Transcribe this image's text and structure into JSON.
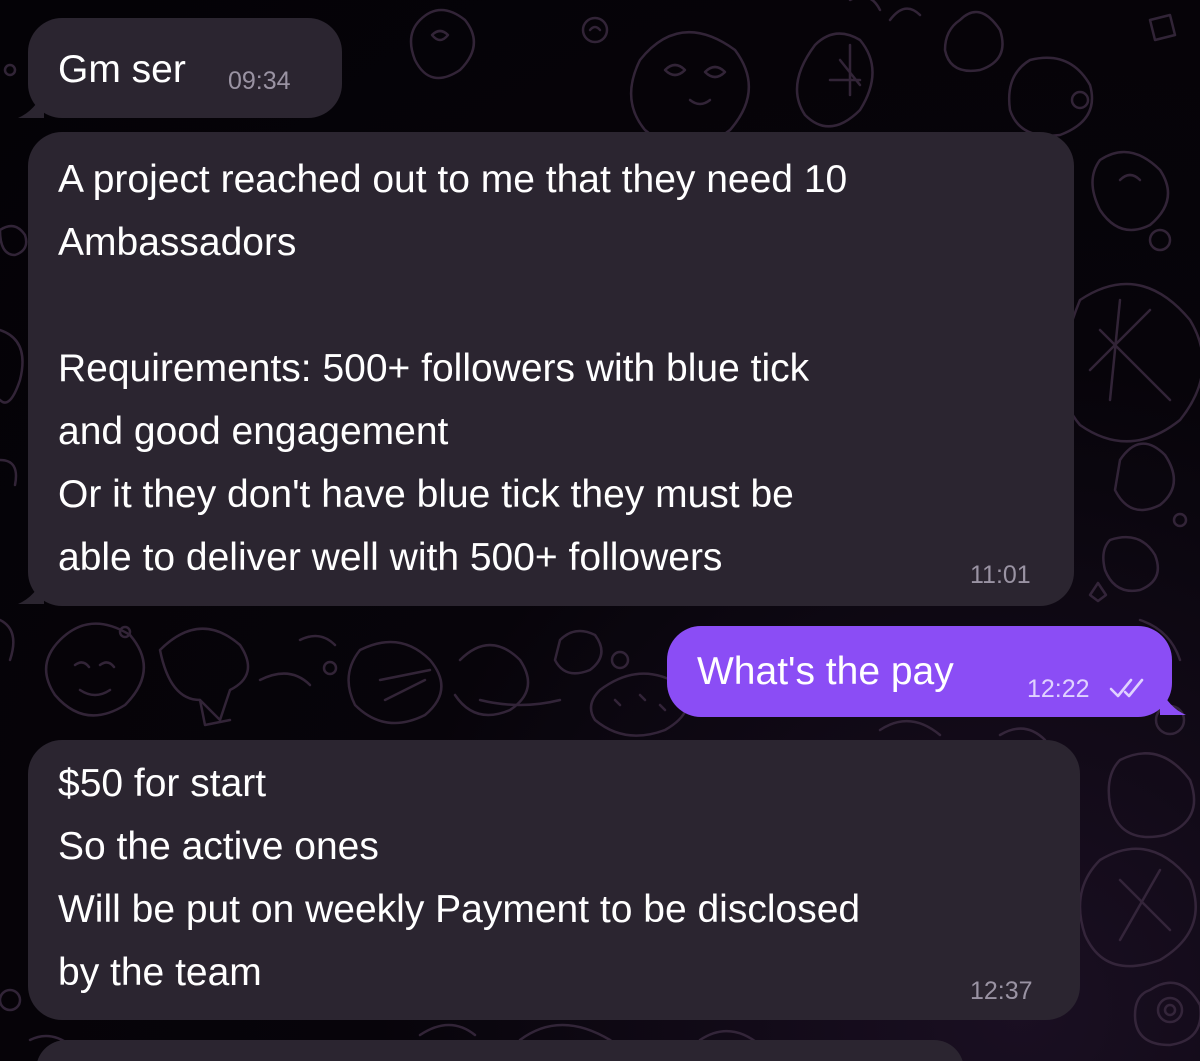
{
  "chat": {
    "messages": [
      {
        "direction": "incoming",
        "lines": [
          "Gm ser"
        ],
        "time": "09:34"
      },
      {
        "direction": "incoming",
        "lines": [
          "A project reached out to me that they need 10",
          "Ambassadors",
          "",
          "Requirements: 500+ followers with blue tick",
          "and good engagement",
          "Or it they don't have blue tick they must be",
          "able to deliver well with 500+ followers"
        ],
        "time": "11:01"
      },
      {
        "direction": "outgoing",
        "lines": [
          "What's the pay"
        ],
        "time": "12:22",
        "status": "read",
        "status_icon": "double-check-icon"
      },
      {
        "direction": "incoming",
        "lines": [
          "$50 for start",
          "So the active ones",
          "Will be put on weekly Payment to be disclosed",
          "by the team"
        ],
        "time": "12:37"
      },
      {
        "direction": "incoming",
        "lines": [],
        "partially_visible": true
      }
    ]
  },
  "colors": {
    "incoming_bubble": "#2b2530",
    "outgoing_bubble": "#8b4df5",
    "background": "#050208",
    "wallpaper_doodle": "#3a2a40",
    "time_incoming": "#9a93a3",
    "time_outgoing": "#e0d2ff"
  },
  "wallpaper": {
    "style": "doodle-pattern"
  }
}
